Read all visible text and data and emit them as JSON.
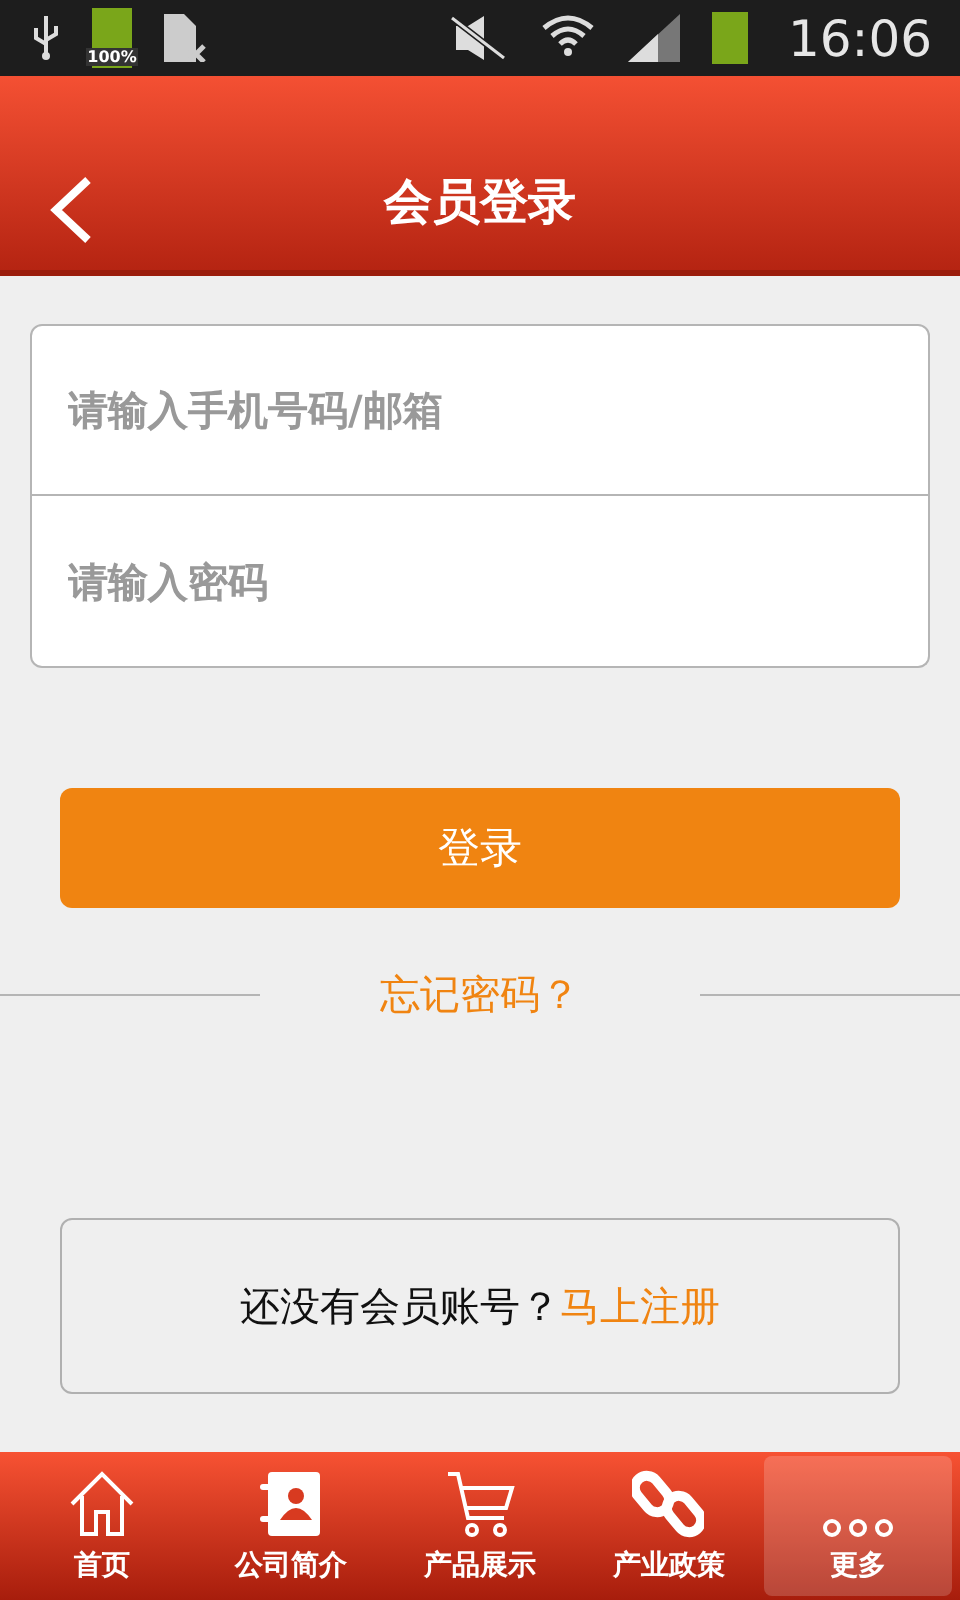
{
  "status_bar": {
    "battery_label": "100%",
    "time": "16:06"
  },
  "header": {
    "title": "会员登录"
  },
  "form": {
    "fields": [
      {
        "placeholder": "请输入手机号码/邮箱"
      },
      {
        "placeholder": "请输入密码"
      }
    ],
    "login_button": "登录",
    "forgot_link": "忘记密码？"
  },
  "register": {
    "prompt": "还没有会员账号？",
    "link": "马上注册"
  },
  "tabs": [
    {
      "label": "首页",
      "selected": false
    },
    {
      "label": "公司简介",
      "selected": false
    },
    {
      "label": "产品展示",
      "selected": false
    },
    {
      "label": "产业政策",
      "selected": false
    },
    {
      "label": "更多",
      "selected": true
    }
  ]
}
